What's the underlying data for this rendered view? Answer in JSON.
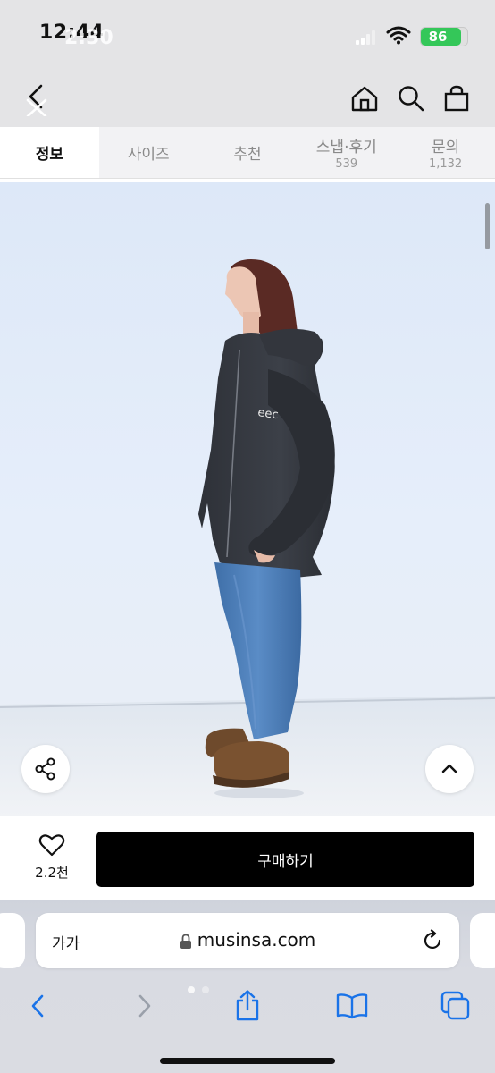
{
  "status": {
    "time": "12:44",
    "time_overlay": "2:30",
    "battery": "86",
    "battery_level": 0.86
  },
  "header": {
    "back_icon": "back-arrow-icon",
    "home_icon": "home-icon",
    "search_icon": "search-icon",
    "cart_icon": "shopping-bag-icon"
  },
  "tabs": [
    {
      "label": "정보",
      "count": "",
      "active": true
    },
    {
      "label": "사이즈",
      "count": "",
      "active": false
    },
    {
      "label": "추천",
      "count": "",
      "active": false
    },
    {
      "label": "스냅·후기",
      "count": "539",
      "active": false
    },
    {
      "label": "문의",
      "count": "1,132",
      "active": false
    }
  ],
  "photo": {
    "share_icon": "share-icon",
    "scroll_top_icon": "chevron-up-icon"
  },
  "buy_bar": {
    "like_icon": "heart-icon",
    "like_count": "2.2천",
    "buy_label": "구매하기"
  },
  "safari": {
    "text_size_label": "가가",
    "domain": "musinsa.com",
    "lock_icon": "lock-icon",
    "reload_icon": "reload-icon",
    "toolbar": [
      "back-icon",
      "forward-icon",
      "share-icon",
      "bookmarks-icon",
      "tabs-icon"
    ]
  }
}
